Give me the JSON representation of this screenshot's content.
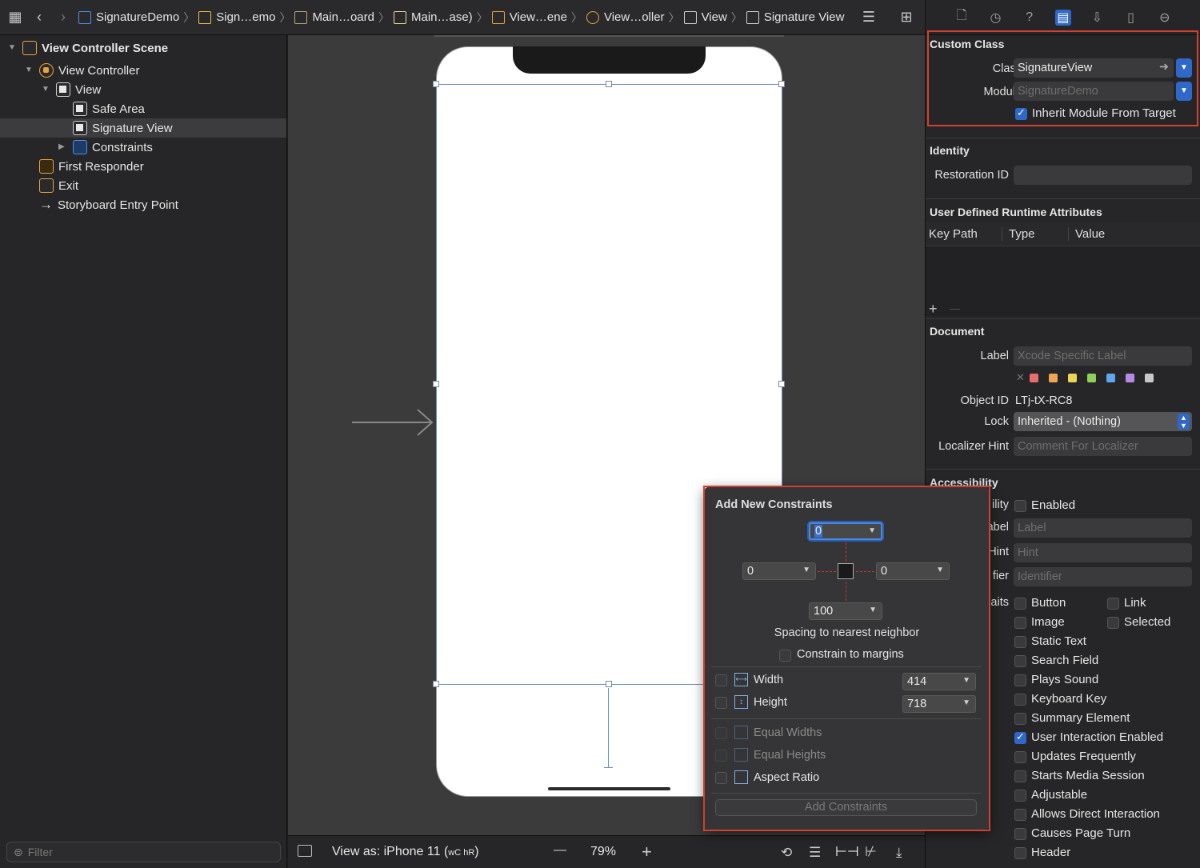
{
  "breadcrumbs": [
    "SignatureDemo",
    "Sign…emo",
    "Main…oard",
    "Main…ase)",
    "View…ene",
    "View…oller",
    "View",
    "Signature View"
  ],
  "navigator": {
    "items": [
      {
        "label": "View Controller Scene",
        "indent": 0,
        "bold": true,
        "icon": "scene-icon",
        "expanded": true
      },
      {
        "label": "View Controller",
        "indent": 1,
        "icon": "view-controller-icon",
        "expanded": true
      },
      {
        "label": "View",
        "indent": 2,
        "icon": "view-icon",
        "expanded": true
      },
      {
        "label": "Safe Area",
        "indent": 3,
        "icon": "safe-area-icon"
      },
      {
        "label": "Signature View",
        "indent": 3,
        "icon": "view-icon",
        "selected": true
      },
      {
        "label": "Constraints",
        "indent": 3,
        "icon": "constraints-icon",
        "collapsed": true
      },
      {
        "label": "First Responder",
        "indent": 1,
        "icon": "first-responder-icon"
      },
      {
        "label": "Exit",
        "indent": 1,
        "icon": "exit-icon"
      },
      {
        "label": "Storyboard Entry Point",
        "indent": 1,
        "icon": "arrow-icon"
      }
    ],
    "filter_placeholder": "Filter"
  },
  "bottombar": {
    "view_as": "View as: iPhone 11 (",
    "size_classes": "wC hR",
    "view_as_end": ")",
    "minus": "—",
    "zoom": "79%",
    "plus": "+"
  },
  "inspector": {
    "custom_class": {
      "title": "Custom Class",
      "class_label": "Class",
      "class_value": "SignatureView",
      "module_label": "Module",
      "module_placeholder": "SignatureDemo",
      "inherit_label": "Inherit Module From Target",
      "inherit_checked": true
    },
    "identity": {
      "title": "Identity",
      "restoration_label": "Restoration ID"
    },
    "runtime": {
      "title": "User Defined Runtime Attributes",
      "col_keypath": "Key Path",
      "col_type": "Type",
      "col_value": "Value",
      "add": "+",
      "remove": "—"
    },
    "document": {
      "title": "Document",
      "label_label": "Label",
      "label_placeholder": "Xcode Specific Label",
      "objectid_label": "Object ID",
      "objectid_value": "LTj-tX-RC8",
      "lock_label": "Lock",
      "lock_value": "Inherited - (Nothing)",
      "localizer_label": "Localizer Hint",
      "localizer_placeholder": "Comment For Localizer",
      "swatch_colors": [
        "#e86d6d",
        "#f0a550",
        "#ecd551",
        "#8fd05a",
        "#5ea6f0",
        "#b58ae6",
        "#c8c8c8"
      ]
    },
    "accessibility": {
      "title": "Accessibility",
      "rows": [
        {
          "label": "ility",
          "text": "Enabled",
          "type": "checkbox"
        },
        {
          "label": "abel",
          "text": "Label",
          "type": "field"
        },
        {
          "label": "Hint",
          "text": "Hint",
          "type": "field"
        },
        {
          "label": "fier",
          "text": "Identifier",
          "type": "field"
        }
      ],
      "traits_label": "aits",
      "traits": [
        {
          "text": "Button",
          "checked": false
        },
        {
          "text": "Link",
          "checked": false
        },
        {
          "text": "Image",
          "checked": false
        },
        {
          "text": "Selected",
          "checked": false
        },
        {
          "text": "Static Text",
          "checked": false
        },
        {
          "text": "Search Field",
          "checked": false
        },
        {
          "text": "Plays Sound",
          "checked": false
        },
        {
          "text": "Keyboard Key",
          "checked": false
        },
        {
          "text": "Summary Element",
          "checked": false
        },
        {
          "text": "User Interaction Enabled",
          "checked": true
        },
        {
          "text": "Updates Frequently",
          "checked": false
        },
        {
          "text": "Starts Media Session",
          "checked": false
        },
        {
          "text": "Adjustable",
          "checked": false
        },
        {
          "text": "Allows Direct Interaction",
          "checked": false
        },
        {
          "text": "Causes Page Turn",
          "checked": false
        },
        {
          "text": "Header",
          "checked": false
        }
      ]
    }
  },
  "popover": {
    "title": "Add New Constraints",
    "top": "0",
    "left": "0",
    "right": "0",
    "bottom": "100",
    "spacing_label": "Spacing to nearest neighbor",
    "margins_label": "Constrain to margins",
    "width_label": "Width",
    "width_value": "414",
    "height_label": "Height",
    "height_value": "718",
    "equal_widths": "Equal Widths",
    "equal_heights": "Equal Heights",
    "aspect_ratio": "Aspect Ratio",
    "add_button": "Add Constraints"
  },
  "colors": {
    "accent": "#2f68c9",
    "highlight": "#d2402f",
    "selection": "#6c8ec2"
  }
}
